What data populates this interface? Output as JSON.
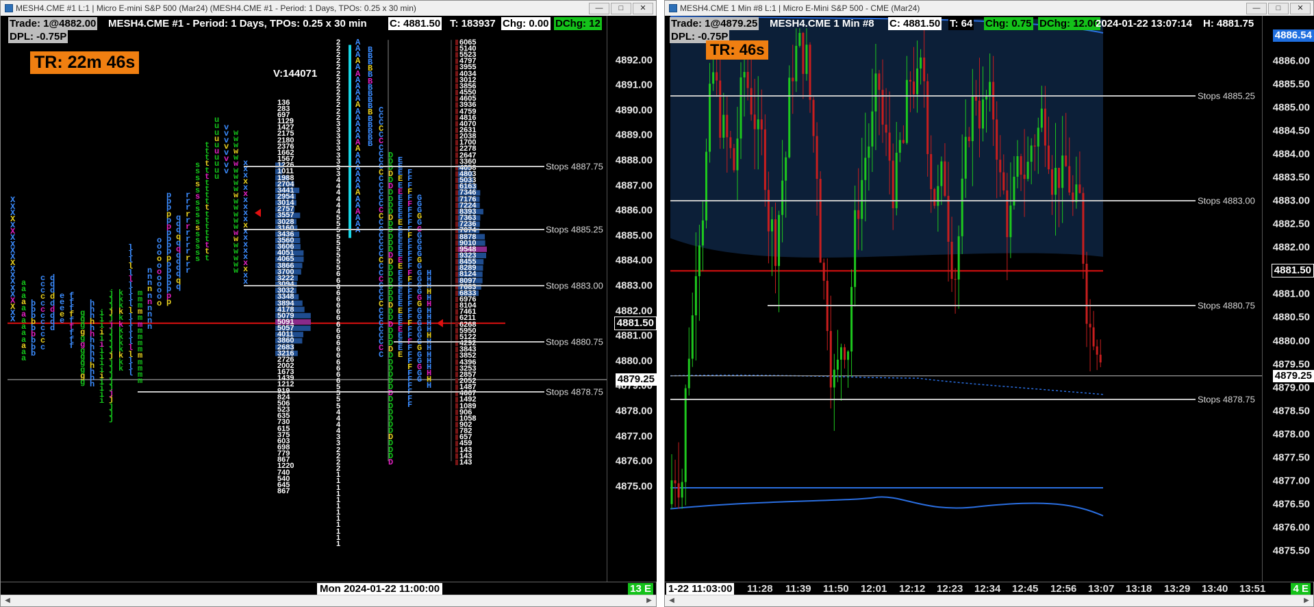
{
  "left": {
    "title": "MESH4.CME #1 L:1 | Micro E-mini S&P 500 (Mar24) (MESH4.CME #1 - Period: 1 Days, TPOs: 0.25 x 30 min)",
    "header": {
      "trade": "Trade: 1@4882.00",
      "symbol_info": "MESH4.CME #1 - Period: 1 Days, TPOs: 0.25 x 30 min",
      "close": "C: 4881.50",
      "total": "T: 183937",
      "chg": "Chg: 0.00",
      "dchg": "DChg: 12",
      "dpl": "DPL: -0.75P"
    },
    "tr": "TR: 22m 46s",
    "volume_total": "V:144071",
    "price_ticks": [
      "4892.00",
      "4891.00",
      "4890.00",
      "4889.00",
      "4888.00",
      "4887.00",
      "4886.00",
      "4885.00",
      "4884.00",
      "4883.00",
      "4882.00",
      "4881.00",
      "4880.00",
      "4879.00",
      "4878.00",
      "4877.00",
      "4876.00",
      "4875.00"
    ],
    "last_price": "4881.50",
    "marker_price": "4879.25",
    "stops": [
      {
        "label": "Stops",
        "price": "4887.75"
      },
      {
        "label": "Stops",
        "price": "4885.25"
      },
      {
        "label": "Stops",
        "price": "4883.00"
      },
      {
        "label": "Stops",
        "price": "4880.75"
      },
      {
        "label": "Stops",
        "price": "4878.75"
      }
    ],
    "date_label": "Mon 2024-01-22  11:00:00",
    "bars_indicator": "13 E",
    "volumes_left": [
      "136",
      "283",
      "697",
      "1129",
      "1427",
      "2175",
      "2180",
      "2376",
      "1662",
      "1567",
      "1226",
      "1011",
      "1988",
      "2704",
      "3441",
      "2954",
      "3014",
      "2757",
      "3557",
      "3028",
      "3160",
      "3436",
      "3560",
      "3606",
      "4051",
      "4065",
      "3866",
      "3700",
      "3222",
      "3094",
      "3032",
      "3348",
      "3894",
      "4178",
      "5079",
      "5091",
      "5057",
      "4011",
      "3860",
      "2683",
      "3216",
      "2726",
      "2002",
      "1673",
      "1439",
      "1212",
      "919",
      "824",
      "506",
      "523",
      "635",
      "730",
      "615",
      "375",
      "603",
      "698",
      "779",
      "867",
      "1220",
      "740",
      "540",
      "645",
      "867"
    ],
    "tpo_counts": [
      "2",
      "2",
      "2",
      "2",
      "2",
      "2",
      "2",
      "2",
      "2",
      "2",
      "2",
      "2",
      "2",
      "3",
      "3",
      "3",
      "3",
      "3",
      "3",
      "3",
      "3",
      "3",
      "4",
      "4",
      "4",
      "4",
      "4",
      "4",
      "5",
      "5",
      "5",
      "5",
      "5",
      "5",
      "5",
      "5",
      "5",
      "6",
      "6",
      "6",
      "6",
      "6",
      "6",
      "6",
      "6",
      "6",
      "6",
      "6",
      "6",
      "6",
      "6",
      "6",
      "6",
      "6",
      "6",
      "5",
      "5",
      "5",
      "5",
      "4",
      "4",
      "4",
      "4",
      "3",
      "3",
      "2",
      "2",
      "2",
      "2",
      "1",
      "1",
      "1",
      "1",
      "1",
      "1",
      "1",
      "1",
      "1",
      "1",
      "1",
      "1"
    ],
    "volumes_right": [
      "6065",
      "5140",
      "5523",
      "4797",
      "3955",
      "4034",
      "3012",
      "3856",
      "4550",
      "4605",
      "3936",
      "4759",
      "4816",
      "4070",
      "2631",
      "2038",
      "1700",
      "2278",
      "2647",
      "3360",
      "4058",
      "4803",
      "5033",
      "6163",
      "7346",
      "7176",
      "7224",
      "8393",
      "7363",
      "7236",
      "7074",
      "8878",
      "9010",
      "9548",
      "9323",
      "8455",
      "8289",
      "8124",
      "8097",
      "7683",
      "6833",
      "6976",
      "8104",
      "7461",
      "6211",
      "6268",
      "5950",
      "5122",
      "4292",
      "3843",
      "3852",
      "4396",
      "3253",
      "2857",
      "2052",
      "1487",
      "4667",
      "1492",
      "1089",
      "906",
      "1058",
      "902",
      "782",
      "657",
      "459",
      "143",
      "143",
      "143"
    ]
  },
  "right": {
    "title": "MESH4.CME  1 Min  #8 L:1 | Micro E-Mini S&P 500 - CME (Mar24)",
    "header": {
      "trade": "Trade: 1@4879.25",
      "symbol_info": "MESH4.CME  1 Min  #8",
      "close": "C: 4881.50",
      "total": "T: 64",
      "chg": "Chg: 0.75",
      "dchg": "DChg: 12.00",
      "datetime": "2024-01-22  13:07:14",
      "high": "H: 4881.75",
      "dpl": "DPL: -0.75P"
    },
    "tr": "TR: 46s",
    "price_ticks": [
      "4886.00",
      "4885.50",
      "4885.00",
      "4884.50",
      "4884.00",
      "4883.50",
      "4883.00",
      "4882.50",
      "4882.00",
      "4881.50",
      "4881.00",
      "4880.50",
      "4880.00",
      "4879.50",
      "4879.00",
      "4878.50",
      "4878.00",
      "4877.50",
      "4877.00",
      "4876.50",
      "4876.00",
      "4875.50"
    ],
    "top_price": "4886.54",
    "last_price": "4881.50",
    "marker_price": "4879.25",
    "stops": [
      {
        "label": "Stops",
        "price": "4885.25"
      },
      {
        "label": "Stops",
        "price": "4883.00"
      },
      {
        "label": "Stops",
        "price": "4880.75"
      },
      {
        "label": "Stops",
        "price": "4878.75"
      }
    ],
    "time_labels": [
      "1-22  11:03:00",
      "11:28",
      "11:39",
      "11:50",
      "12:01",
      "12:12",
      "12:23",
      "12:34",
      "12:45",
      "12:56",
      "13:07",
      "13:18",
      "13:29",
      "13:40",
      "13:51"
    ],
    "bars_indicator": "4 E"
  },
  "colors": {
    "bg": "#000000",
    "green_box": "#14c21a",
    "orange": "#f07f11",
    "red_line": "#e01010",
    "stops_line": "#c8c8c8",
    "shade": "#0c1f38",
    "up_candle": "#1ec81e",
    "down_candle": "#c81e1e"
  },
  "icons": [
    "minimize-icon",
    "maximize-icon",
    "close-icon",
    "scroll-left-icon",
    "scroll-right-icon"
  ]
}
